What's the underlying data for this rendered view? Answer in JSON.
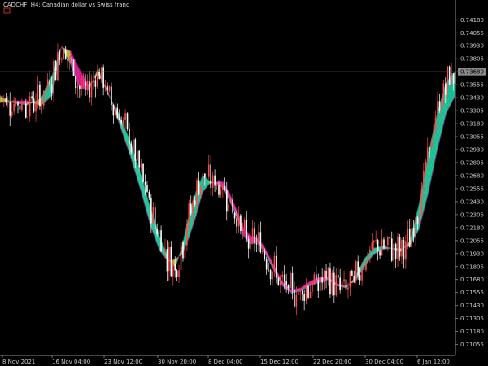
{
  "header": {
    "symbol": "CADCHF",
    "timeframe": "H4",
    "description": "Canadian dollar vs Swiss franc",
    "title": "CADCHF, H4:  Canadian dollar vs Swiss franc"
  },
  "current_price": {
    "value": 0.7368,
    "label": "0.73680"
  },
  "colors": {
    "background": "#000000",
    "axis": "#8a8a8a",
    "text": "#c8c8c8",
    "bull_candle": "#ff4d4d",
    "bear_candle": "#ffffff",
    "ribbon_up": "#12c79a",
    "ribbon_up_dark": "#0d8f6f",
    "ribbon_down": "#d8108f",
    "ribbon_down_dark": "#8e0b63",
    "ribbon_transition": "#c8b820",
    "ribbon_line": "#ffb3d9",
    "price_line": "#6e6e6e",
    "price_tag": "#8a8a8a"
  },
  "chart_data": {
    "type": "line",
    "title": "CADCHF, H4:  Canadian dollar vs Swiss franc",
    "ylim": [
      0.7095,
      0.7437
    ],
    "y_ticks": [
      "0.74180",
      "0.74055",
      "0.73930",
      "0.73805",
      "0.73680",
      "0.73555",
      "0.73430",
      "0.73305",
      "0.73180",
      "0.73055",
      "0.72930",
      "0.72805",
      "0.72680",
      "0.72555",
      "0.72430",
      "0.72305",
      "0.72180",
      "0.72055",
      "0.71930",
      "0.71805",
      "0.71680",
      "0.71555",
      "0.71430",
      "0.71305",
      "0.71180",
      "0.71055"
    ],
    "x_ticks": [
      "8 Nov 2021",
      "16 Nov 04:00",
      "23 Nov 12:00",
      "30 Nov 20:00",
      "8 Dec 04:00",
      "15 Dec 12:00",
      "22 Dec 20:00",
      "30 Dec 04:00",
      "6 Jan 12:00"
    ],
    "grid": false,
    "legend": "none",
    "series": [
      {
        "x": [
          0,
          0.03,
          0.06,
          0.09,
          0.115,
          0.135,
          0.155,
          0.175,
          0.195,
          0.215,
          0.235,
          0.26,
          0.285,
          0.31,
          0.33,
          0.35,
          0.37,
          0.385,
          0.4,
          0.415,
          0.43,
          0.445,
          0.46,
          0.475,
          0.49,
          0.505,
          0.52,
          0.535,
          0.55,
          0.565,
          0.58,
          0.6,
          0.62,
          0.64,
          0.66,
          0.68,
          0.7,
          0.72,
          0.74,
          0.76,
          0.78,
          0.8,
          0.82,
          0.84,
          0.86,
          0.88,
          0.9,
          0.92,
          0.94,
          0.96,
          0.98,
          1.0
        ],
        "values": [
          0.7344,
          0.7338,
          0.7336,
          0.7342,
          0.7365,
          0.7392,
          0.7375,
          0.7352,
          0.735,
          0.7371,
          0.7348,
          0.7328,
          0.7302,
          0.7268,
          0.7237,
          0.721,
          0.7188,
          0.718,
          0.72,
          0.723,
          0.7252,
          0.7268,
          0.7263,
          0.726,
          0.7256,
          0.7243,
          0.7228,
          0.721,
          0.7202,
          0.7204,
          0.7195,
          0.7178,
          0.7162,
          0.7155,
          0.7157,
          0.7162,
          0.7165,
          0.7168,
          0.7162,
          0.716,
          0.717,
          0.7188,
          0.7198,
          0.72,
          0.7198,
          0.7195,
          0.7205,
          0.724,
          0.7288,
          0.7328,
          0.7358,
          0.7368
        ]
      },
      {
        "x": [
          0,
          0.03,
          0.06,
          0.09,
          0.115,
          0.135,
          0.155,
          0.175,
          0.195,
          0.215,
          0.235,
          0.26,
          0.285,
          0.31,
          0.33,
          0.35,
          0.37,
          0.385,
          0.4,
          0.415,
          0.43,
          0.445,
          0.46,
          0.475,
          0.49,
          0.505,
          0.52,
          0.535,
          0.55,
          0.565,
          0.58,
          0.6,
          0.62,
          0.64,
          0.66,
          0.68,
          0.7,
          0.72,
          0.74,
          0.76,
          0.78,
          0.8,
          0.82,
          0.84,
          0.86,
          0.88,
          0.9,
          0.92,
          0.94,
          0.96,
          0.98,
          1.0
        ],
        "values": [
          0.7338,
          0.734,
          0.734,
          0.7335,
          0.7345,
          0.7392,
          0.7388,
          0.737,
          0.7355,
          0.7365,
          0.7352,
          0.732,
          0.7288,
          0.7252,
          0.722,
          0.7196,
          0.7185,
          0.7188,
          0.7192,
          0.7208,
          0.7228,
          0.7252,
          0.726,
          0.7262,
          0.7262,
          0.725,
          0.7235,
          0.7218,
          0.721,
          0.7208,
          0.72,
          0.7183,
          0.7166,
          0.7158,
          0.716,
          0.7166,
          0.717,
          0.717,
          0.7164,
          0.7162,
          0.7166,
          0.718,
          0.7192,
          0.7197,
          0.7198,
          0.7198,
          0.72,
          0.7216,
          0.725,
          0.7292,
          0.7328,
          0.7345
        ]
      }
    ]
  }
}
